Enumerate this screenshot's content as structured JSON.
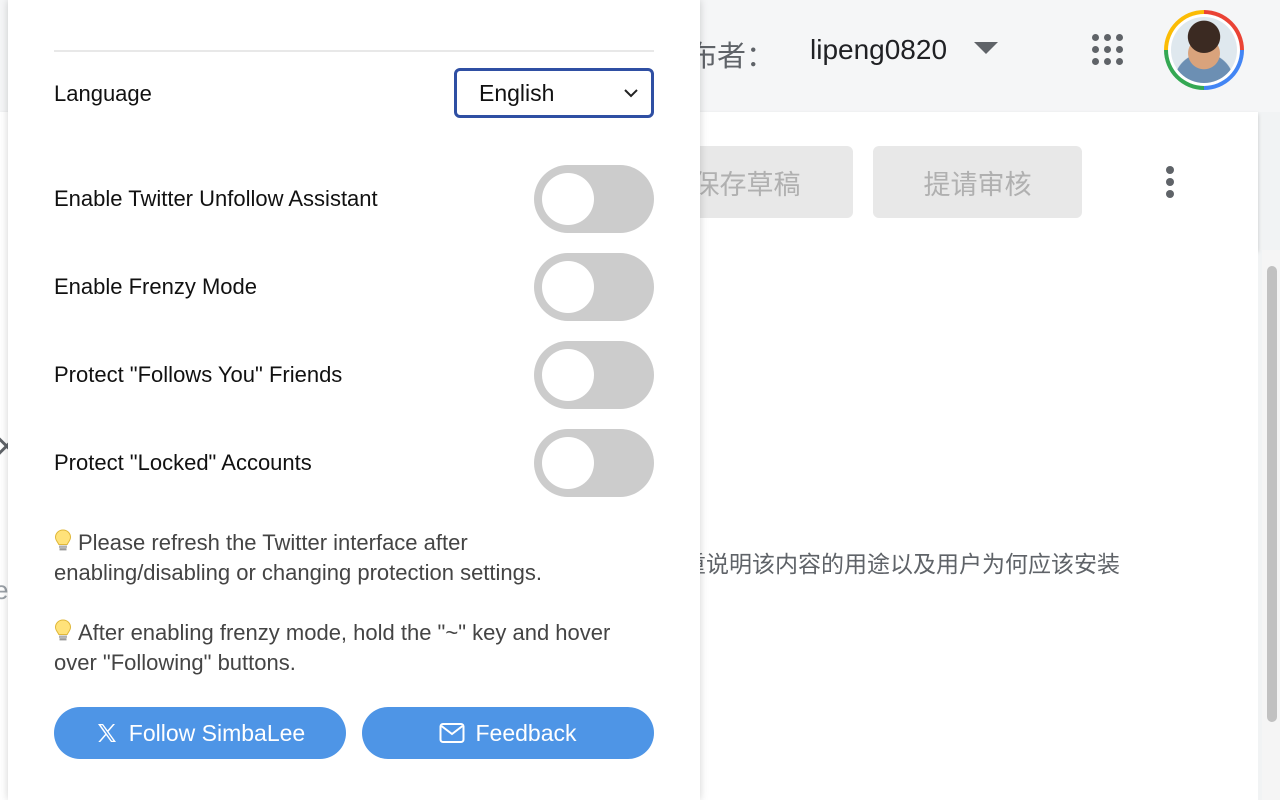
{
  "background": {
    "header": {
      "publisher_label": "布者：",
      "username": "lipeng0820",
      "apps_icon": "apps-grid-icon",
      "avatar_icon": "avatar"
    },
    "toolbar": {
      "save_draft_label": "保存草稿",
      "submit_review_label": "提请审核",
      "more_icon": "more-vertical-icon"
    },
    "content": {
      "description_line1": "着重说明该内容的用途以及用户为何应该安装",
      "description_line2": "，"
    }
  },
  "popup": {
    "language": {
      "label": "Language",
      "selected": "English"
    },
    "settings": [
      {
        "label": "Enable Twitter Unfollow Assistant",
        "enabled": false
      },
      {
        "label": "Enable Frenzy Mode",
        "enabled": false
      },
      {
        "label": "Protect \"Follows You\" Friends",
        "enabled": false
      },
      {
        "label": "Protect \"Locked\" Accounts",
        "enabled": false
      }
    ],
    "tips": [
      {
        "icon": "lightbulb-icon",
        "text": "Please refresh the Twitter interface after enabling/disabling or changing protection settings."
      },
      {
        "icon": "lightbulb-icon",
        "text": "After enabling frenzy mode, hold the \"~\" key and hover over \"Following\" buttons."
      }
    ],
    "buttons": {
      "follow_label": "Follow SimbaLee",
      "feedback_label": "Feedback"
    },
    "colors": {
      "accent": "#4e95e6",
      "select_border": "#2f4fa3",
      "toggle_off": "#cccccc"
    }
  }
}
